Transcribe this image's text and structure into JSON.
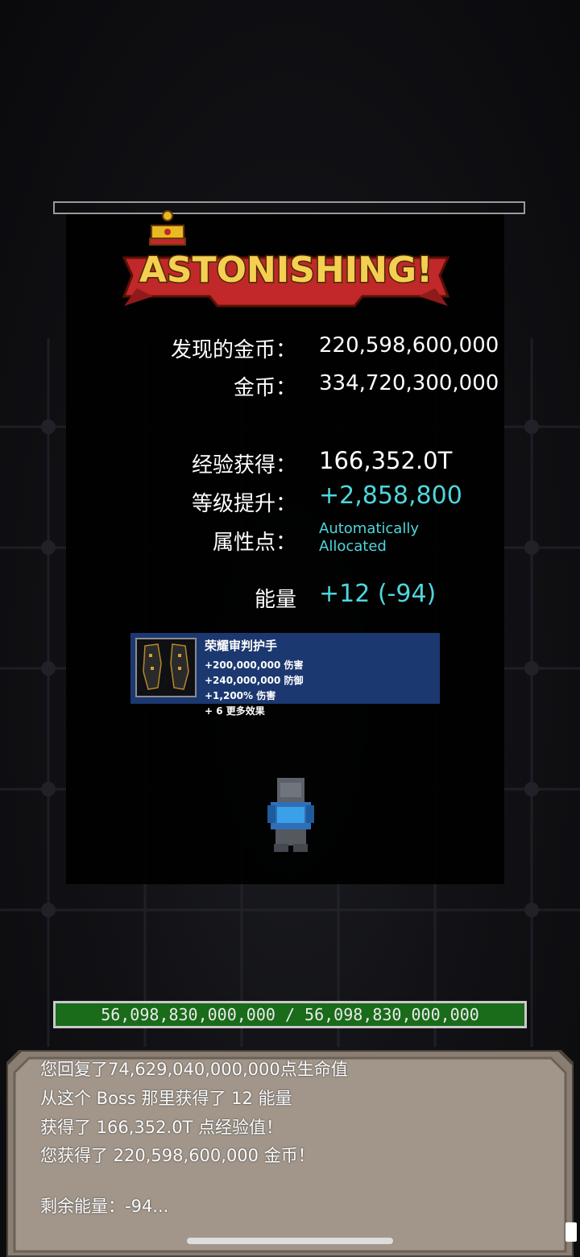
{
  "banner": {
    "text": "ASTONISHING!"
  },
  "results": {
    "gold_found_label": "发现的金币：",
    "gold_found_value": "220,598,600,000",
    "gold_label": "金币：",
    "gold_value": "334,720,300,000",
    "exp_label": "经验获得：",
    "exp_value": "166,352.0T",
    "level_label": "等级提升：",
    "level_value": "+2,858,800",
    "attr_label": "属性点：",
    "attr_value_1": "Automatically",
    "attr_value_2": "Allocated",
    "energy_label": "能量",
    "energy_value": "+12 (-94)"
  },
  "item": {
    "name": "荣耀审判护手",
    "stats": [
      "+200,000,000 伤害",
      "+240,000,000 防御",
      "+1,200% 伤害",
      "+ 6 更多效果"
    ],
    "icon": "gauntlet-icon"
  },
  "hp_bar": {
    "text": "56,098,830,000,000 / 56,098,830,000,000",
    "fill": 1.0
  },
  "log": {
    "lines": [
      "您回复了74,629,040,000,000点生命值",
      "从这个 Boss 那里获得了 12 能量",
      "获得了 166,352.0T 点经验值！",
      "您获得了 220,598,600,000 金币！",
      "剩余能量：-94..."
    ]
  },
  "colors": {
    "accent": "#4fd6dc",
    "item_bg": "#1c3870",
    "hp_fill": "#1a6b1a"
  }
}
